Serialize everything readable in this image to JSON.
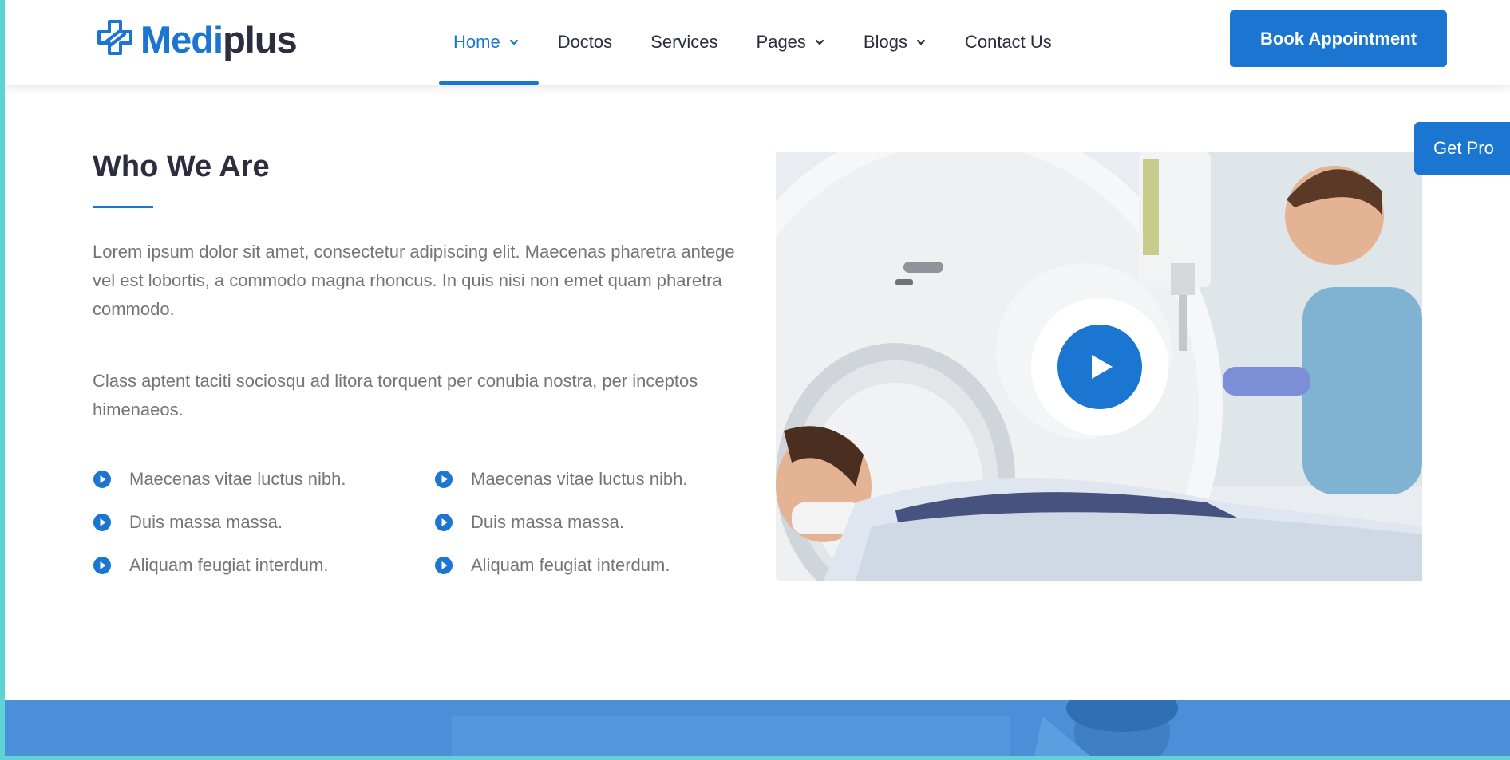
{
  "brand": {
    "name_part1": "Medi",
    "name_part2": "plus",
    "colors": {
      "primary": "#1a76d1",
      "dark": "#2c2d3f",
      "text": "#757575"
    }
  },
  "nav": {
    "items": [
      {
        "label": "Home",
        "active": true,
        "dropdown": true
      },
      {
        "label": "Doctos",
        "active": false,
        "dropdown": false
      },
      {
        "label": "Services",
        "active": false,
        "dropdown": false
      },
      {
        "label": "Pages",
        "active": false,
        "dropdown": true
      },
      {
        "label": "Blogs",
        "active": false,
        "dropdown": true
      },
      {
        "label": "Contact Us",
        "active": false,
        "dropdown": false
      }
    ],
    "cta": "Book Appointment"
  },
  "sidebar_tab": {
    "label": "Get Pro"
  },
  "about": {
    "title": "Who We Are",
    "paragraphs": [
      "Lorem ipsum dolor sit amet, consectetur adipiscing elit. Maecenas pharetra antege vel est lobortis, a commodo magna rhoncus. In quis nisi non emet quam pharetra commodo.",
      "Class aptent taciti sociosqu ad litora torquent per conubia nostra, per inceptos himenaeos."
    ],
    "features": [
      "Maecenas vitae luctus nibh.",
      "Maecenas vitae luctus nibh.",
      "Duis massa massa.",
      "Duis massa massa.",
      "Aliquam feugiat interdum.",
      "Aliquam feugiat interdum."
    ],
    "video_icon": "play-icon"
  }
}
